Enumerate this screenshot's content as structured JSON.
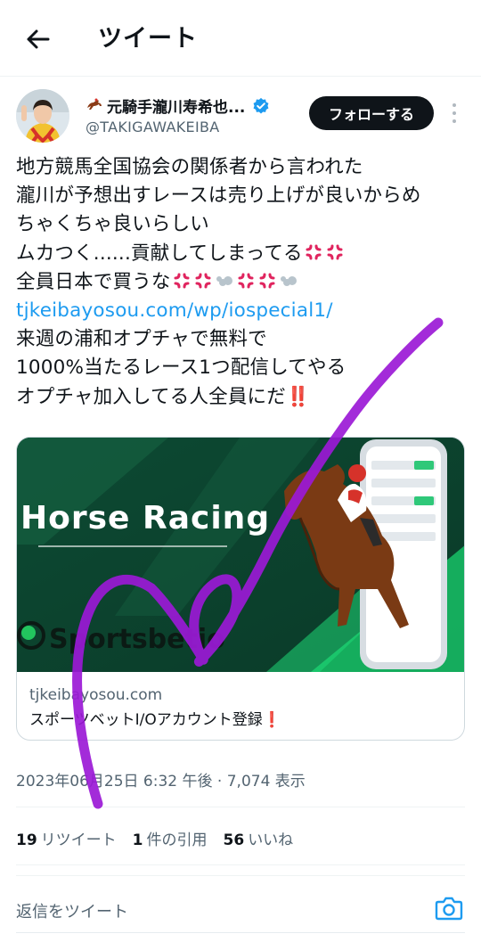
{
  "header": {
    "back_icon": "arrow-left-icon",
    "title": "ツイート"
  },
  "author": {
    "display_name": "元騎手瀧川寿希也...",
    "name_prefix_icon": "horse-racing-icon",
    "verified_icon": "verified-badge-icon",
    "verified_color": "#1d9bf0",
    "handle": "@TAKIGAWAKEIBA",
    "follow_label": "フォローする",
    "more_icon": "more-vertical-icon"
  },
  "tweet": {
    "line1": "地方競馬全国協会の関係者から言われた",
    "line2": "瀧川が予想出すレースは売り上げが良いからめ",
    "line3": "ちゃくちゃ良いらしい",
    "line4": "ムカつく......貢献してしまってる",
    "line5": "全員日本で買うな",
    "link": "tjkeibayosou.com/wp/iospecial1/",
    "line7": "来週の浦和オプチャで無料で",
    "line8": "1000%当たるレース1つ配信してやる",
    "line9": "オプチャ加入してる人全員にだ",
    "emoji_anger": "anger-symbol-icon",
    "emoji_dash": "dash-icon",
    "emoji_exclaim": "‼️",
    "link_color": "#1d9bf0"
  },
  "card": {
    "image_title": "Horse Racing",
    "image_brand": "Sportsbetio",
    "domain": "tjkeibayosou.com",
    "title": "スポーツベットI/Oアカウント登録❗"
  },
  "meta": {
    "timestamp": "2023年06月25日 6:32 午後 · 7,074 表示"
  },
  "stats": {
    "retweets_count": "19",
    "retweets_label": "リツイート",
    "quotes_count": "1",
    "quotes_label": "件の引用",
    "likes_count": "56",
    "likes_label": "いいね"
  },
  "reply": {
    "placeholder": "返信をツイート",
    "camera_icon": "camera-icon",
    "accent": "#1d9bf0"
  },
  "overlay": {
    "scribble_color": "#9b19d6"
  }
}
